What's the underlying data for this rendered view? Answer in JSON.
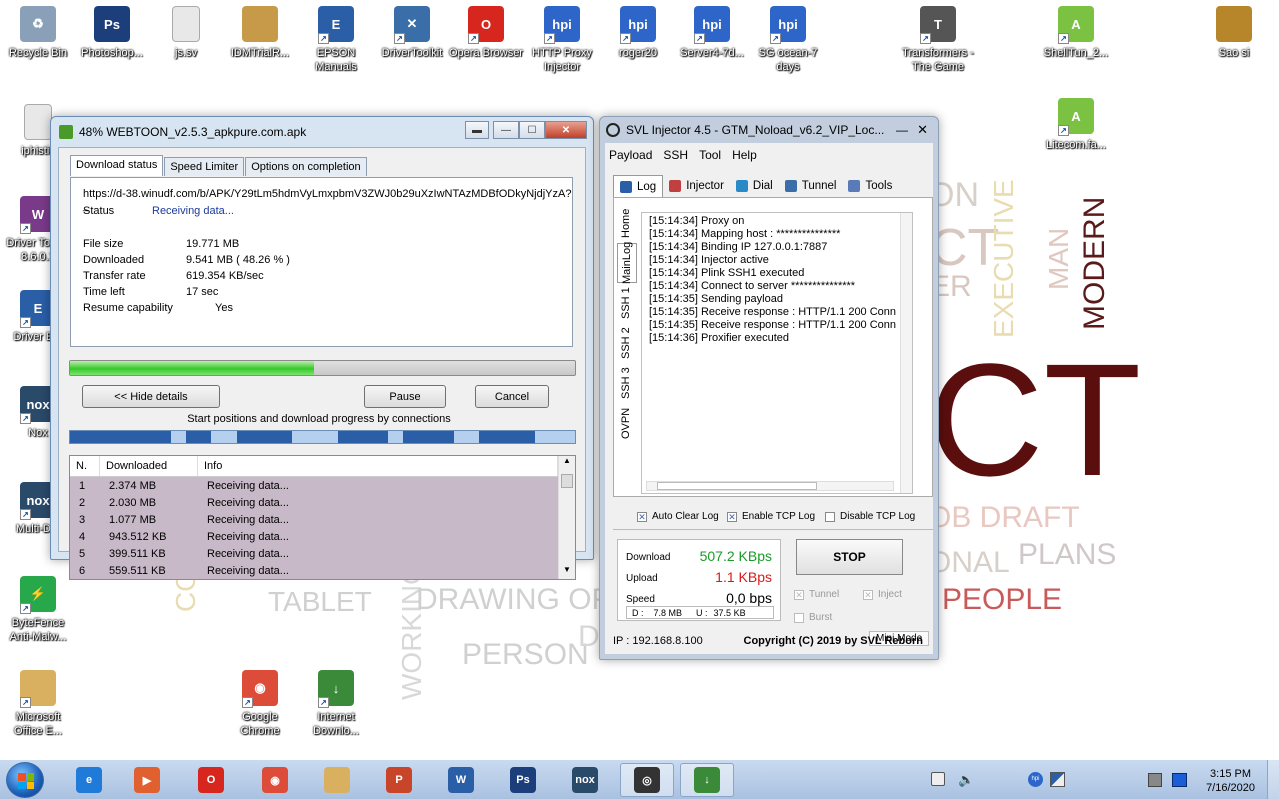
{
  "desktop": {
    "icons": [
      {
        "label": "Recycle Bin",
        "color": "#8aa0b8",
        "glyph": "♻"
      },
      {
        "label": "Photoshop...",
        "color": "#1c3e7a",
        "glyph": "Ps"
      },
      {
        "label": "js.sv",
        "color": "#e8e8e8",
        "glyph": ""
      },
      {
        "label": "IDMTrialR...",
        "color": "#c79a4a",
        "glyph": ""
      },
      {
        "label": "EPSON Manuals",
        "color": "#2a5fa8",
        "glyph": "E"
      },
      {
        "label": "DriverToolkit",
        "color": "#3a6ea8",
        "glyph": "✕"
      },
      {
        "label": "Opera Browser",
        "color": "#d7261e",
        "glyph": "O"
      },
      {
        "label": "HTTP Proxy Injector",
        "color": "#2d66c8",
        "glyph": "hpi"
      },
      {
        "label": "roger20",
        "color": "#2d66c8",
        "glyph": "hpi"
      },
      {
        "label": "Server4-7d...",
        "color": "#2d66c8",
        "glyph": "hpi"
      },
      {
        "label": "SG ocean-7 days",
        "color": "#2d66c8",
        "glyph": "hpi"
      },
      {
        "label": "Transformers - The Game",
        "color": "#555",
        "glyph": "T"
      },
      {
        "label": "ShellTun_2...",
        "color": "#7bc142",
        "glyph": "A"
      },
      {
        "label": "Sao si",
        "color": "#b8862a",
        "glyph": ""
      },
      {
        "label": "Litecom.fa...",
        "color": "#7bc142",
        "glyph": "A"
      },
      {
        "label": "iphistic",
        "color": "#e8e8e8",
        "glyph": ""
      },
      {
        "label": "Driver To... V 8.6.0.1",
        "color": "#7a3a8a",
        "glyph": "W"
      },
      {
        "label": "Driver E...",
        "color": "#2a5fa8",
        "glyph": "E"
      },
      {
        "label": "Nox",
        "color": "#2a4a6a",
        "glyph": "nox"
      },
      {
        "label": "Multi-D...",
        "color": "#2a4a6a",
        "glyph": "nox"
      },
      {
        "label": "ByteFence Anti-Malw...",
        "color": "#27a84a",
        "glyph": "⚡"
      },
      {
        "label": "Microsoft Office E...",
        "color": "#d8b060",
        "glyph": ""
      },
      {
        "label": "Google Chrome",
        "color": "#dd4b39",
        "glyph": "◉"
      },
      {
        "label": "Internet Downlo...",
        "color": "#3a8a3a",
        "glyph": "↓"
      }
    ]
  },
  "wallpaper": {
    "words": [
      "ON",
      "CT",
      "ER",
      "EXECUTIVE",
      "MAN",
      "MODERN",
      "CT",
      "OB DRAFT",
      "ONAL",
      "PLANS",
      "PEOPLE",
      "DOCUMENT",
      "TABLET",
      "WORKING",
      "DRAWING OFF",
      "PERSON",
      "DOC",
      "D",
      "CO"
    ]
  },
  "idm": {
    "title": "48% WEBTOON_v2.5.3_apkpure.com.apk",
    "tabs": [
      "Download status",
      "Speed Limiter",
      "Options on completion"
    ],
    "url": "https://d-38.winudf.com/b/APK/Y29tLm5hdmVyLmxpbmV3ZWJ0b29uXzIwNTAzMDBfODkyNjdjYzA?_",
    "status_label": "Status",
    "status_value": "Receiving data...",
    "fields": [
      {
        "label": "File size",
        "value": "19.771  MB"
      },
      {
        "label": "Downloaded",
        "value": "9.541  MB  ( 48.26 % )"
      },
      {
        "label": "Transfer rate",
        "value": "619.354  KB/sec"
      },
      {
        "label": "Time left",
        "value": "17 sec"
      },
      {
        "label": "Resume capability",
        "value": "Yes"
      }
    ],
    "progress_fraction": 0.4826,
    "hide_details": "<< Hide details",
    "pause": "Pause",
    "cancel": "Cancel",
    "connections_caption": "Start positions and download progress by connections",
    "columns": [
      "N.",
      "Downloaded",
      "Info"
    ],
    "rows": [
      {
        "n": "1",
        "downloaded": "2.374  MB",
        "info": "Receiving data..."
      },
      {
        "n": "2",
        "downloaded": "2.030  MB",
        "info": "Receiving data..."
      },
      {
        "n": "3",
        "downloaded": "1.077  MB",
        "info": "Receiving data..."
      },
      {
        "n": "4",
        "downloaded": "943.512  KB",
        "info": "Receiving data..."
      },
      {
        "n": "5",
        "downloaded": "399.511  KB",
        "info": "Receiving data..."
      },
      {
        "n": "6",
        "downloaded": "559.511  KB",
        "info": "Receiving data..."
      }
    ]
  },
  "svl": {
    "title": "SVL Injector 4.5 - GTM_Noload_v6.2_VIP_Loc...",
    "menu": [
      "Payload",
      "SSH",
      "Tool",
      "Help"
    ],
    "tabs": [
      {
        "label": "Log",
        "color": "#2a5fa8"
      },
      {
        "label": "Injector",
        "color": "#c04040"
      },
      {
        "label": "Dial",
        "color": "#2a8ac8"
      },
      {
        "label": "Tunnel",
        "color": "#3a6ea8"
      },
      {
        "label": "Tools",
        "color": "#5a7ab8"
      }
    ],
    "side_tabs": [
      "Home",
      "MainLog",
      "SSH 1",
      "SSH 2",
      "SSH 3",
      "OVPN"
    ],
    "log": [
      "[15:14:34] Proxy on",
      "[15:14:34] Mapping host : ***************",
      "[15:14:34] Binding IP 127.0.0.1:7887",
      "[15:14:34] Injector active",
      "[15:14:34] Plink SSH1 executed",
      "[15:14:34] Connect to server ***************",
      "[15:14:35] Sending payload",
      "[15:14:35] Receive response : HTTP/1.1 200 Conn",
      "[15:14:35] Receive response : HTTP/1.1 200 Conn",
      "[15:14:36] Proxifier executed"
    ],
    "checks": [
      "Auto Clear Log",
      "Enable TCP Log",
      "Disable TCP Log"
    ],
    "download_label": "Download",
    "download_value": "507.2 KBps",
    "upload_label": "Upload",
    "upload_value": "1.1 KBps",
    "speed_label": "Speed",
    "speed_value": "0,0 bps",
    "d_label": "D :",
    "d_value": "7.8 MB",
    "u_label": "U :",
    "u_value": "37.5 KB",
    "stop": "STOP",
    "opt_tunnel": "Tunnel",
    "opt_inject": "Inject",
    "opt_burst": "Burst",
    "mini_mode": "Mini Mode",
    "ip": "IP : 192.168.8.100",
    "copyright": "Copyright (C) 2019 by SVL Reborn"
  },
  "taskbar": {
    "apps": [
      {
        "name": "ie",
        "color": "#1f7ad8",
        "glyph": "e"
      },
      {
        "name": "media",
        "color": "#e06030",
        "glyph": "▶"
      },
      {
        "name": "opera",
        "color": "#d7261e",
        "glyph": "O"
      },
      {
        "name": "chrome",
        "color": "#dd4b39",
        "glyph": "◉"
      },
      {
        "name": "explorer",
        "color": "#d8b060",
        "glyph": ""
      },
      {
        "name": "powerpoint",
        "color": "#c8452a",
        "glyph": "P"
      },
      {
        "name": "word",
        "color": "#2a5fa8",
        "glyph": "W"
      },
      {
        "name": "photoshop",
        "color": "#1c3e7a",
        "glyph": "Ps"
      },
      {
        "name": "nox",
        "color": "#2a4a6a",
        "glyph": "nox"
      },
      {
        "name": "svl",
        "color": "#333",
        "glyph": "◎"
      },
      {
        "name": "idm",
        "color": "#3a8a3a",
        "glyph": "↓"
      }
    ],
    "time": "3:15 PM",
    "date": "7/16/2020"
  }
}
